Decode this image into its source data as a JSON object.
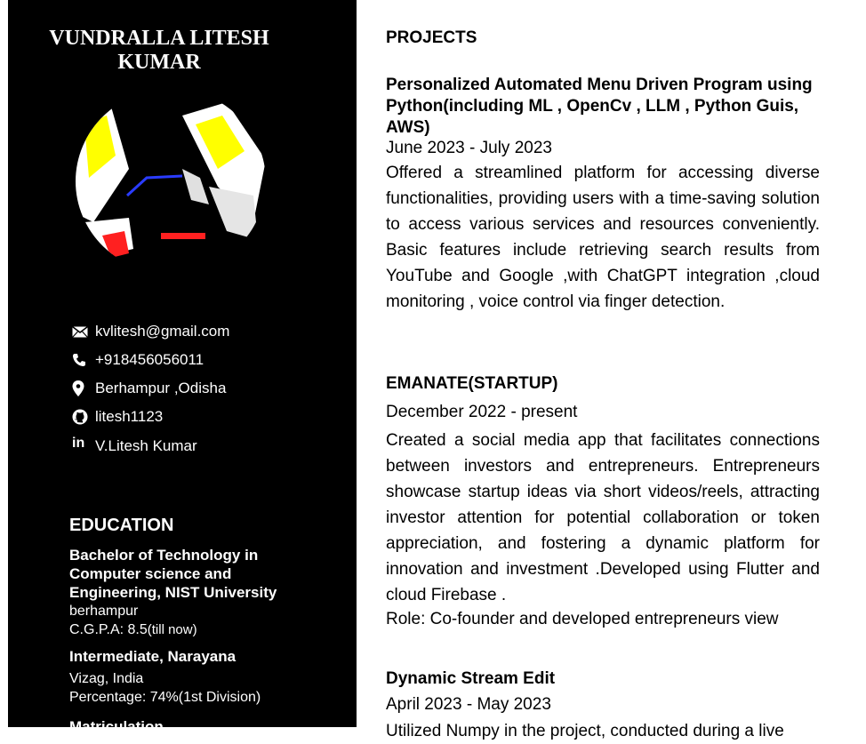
{
  "sidebar": {
    "name": "VUNDRALLA LITESH KUMAR",
    "contacts": {
      "email": "kvlitesh@gmail.com",
      "phone": "+918456056011",
      "location": "Berhampur ,Odisha",
      "github": "litesh1123",
      "linkedin": "V.Litesh Kumar"
    },
    "icons": [
      "email-icon",
      "phone-icon",
      "location-pin-icon",
      "github-icon",
      "linkedin-icon"
    ],
    "education": {
      "title": "EDUCATION",
      "items": [
        {
          "degree": "Bachelor of Technology in Computer science and Engineering, NIST University",
          "place": "berhampur",
          "score": "C.G.P.A: 8.5",
          "note": "(till now)"
        },
        {
          "degree": "Intermediate, Narayana",
          "place": "Vizag, India",
          "score": "Percentage: 74%(1st Division)"
        },
        {
          "degree": "Matriculation"
        }
      ]
    },
    "colors": {
      "background": "#000000",
      "text": "#ffffff"
    }
  },
  "main": {
    "section_title": "PROJECTS",
    "projects": [
      {
        "title": "Personalized Automated Menu Driven Program using Python(including ML , OpenCv , LLM , Python Guis, AWS)",
        "dates": "June 2023  - July 2023",
        "description": "Offered a streamlined platform for accessing diverse functionalities, providing users with a time-saving solution to access various services and resources conveniently. Basic features include retrieving search results from YouTube and Google ,with ChatGPT integration ,cloud monitoring , voice control via finger detection."
      },
      {
        "title": "EMANATE(STARTUP)",
        "dates": "December 2022 - present",
        "description": "Created a social media app that facilitates connections between investors and entrepreneurs. Entrepreneurs showcase startup ideas via short videos/reels, attracting investor attention for potential collaboration or token appreciation, and fostering a dynamic platform for innovation and investment .Developed using Flutter and cloud Firebase .",
        "role": "Role: Co-founder and developed entrepreneurs view"
      },
      {
        "title": "Dynamic Stream Edit",
        "dates": "April 2023 - May 2023",
        "description": "Utilized Numpy in the project, conducted during a live"
      }
    ]
  }
}
